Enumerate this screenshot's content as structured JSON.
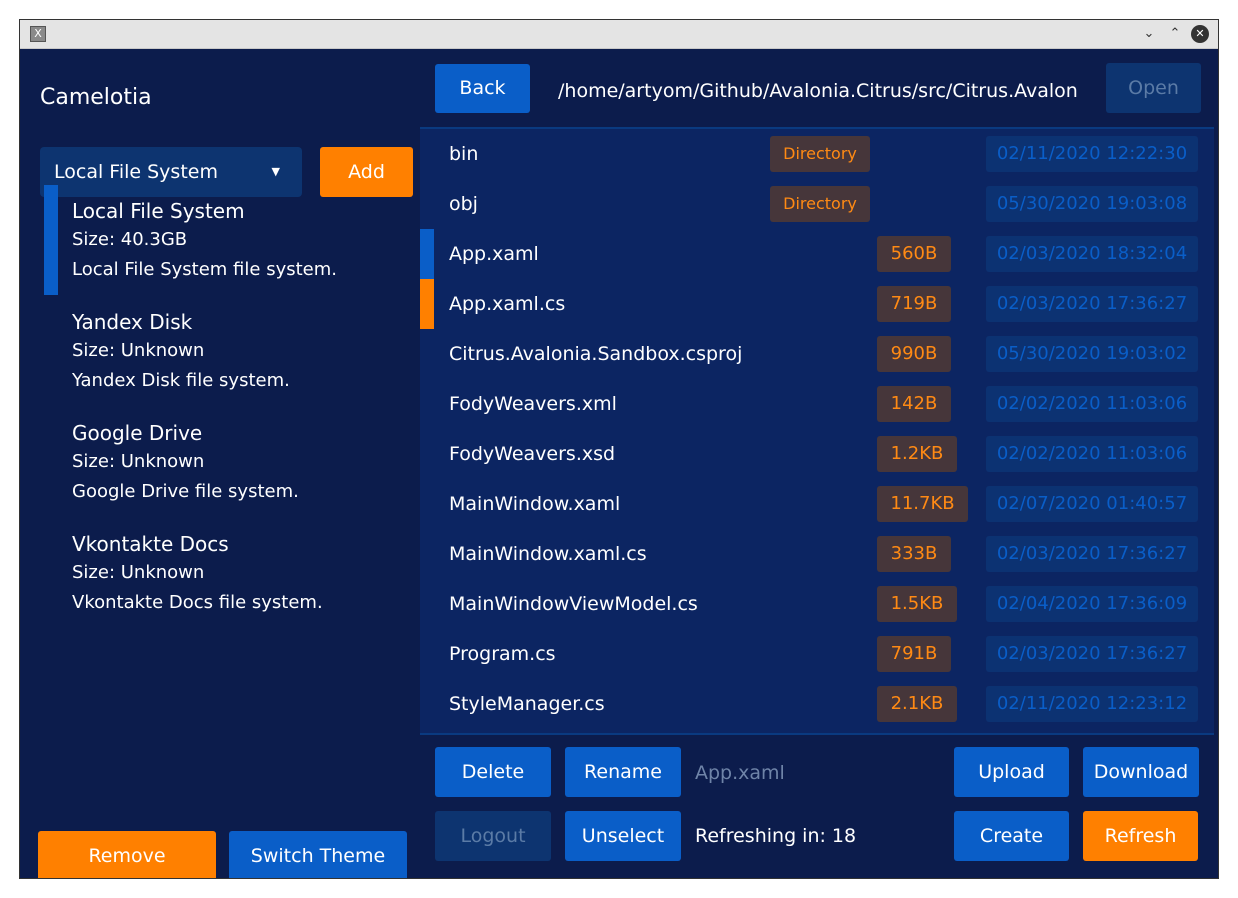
{
  "window": {
    "app_icon": "app-icon",
    "controls": {
      "minimize": "⌄",
      "maximize": "⌃",
      "close": "✕"
    }
  },
  "sidebar": {
    "title": "Camelotia",
    "selector_value": "Local File System",
    "selector_caret": "▼",
    "add_label": "Add",
    "providers": [
      {
        "name": "Local File System",
        "size": "Size: 40.3GB",
        "description": "Local File System file system.",
        "selected": true
      },
      {
        "name": "Yandex Disk",
        "size": "Size: Unknown",
        "description": "Yandex Disk file system.",
        "selected": false
      },
      {
        "name": "Google Drive",
        "size": "Size: Unknown",
        "description": "Google Drive file system.",
        "selected": false
      },
      {
        "name": "Vkontakte Docs",
        "size": "Size: Unknown",
        "description": "Vkontakte Docs file system.",
        "selected": false
      }
    ],
    "remove_label": "Remove",
    "switch_theme_label": "Switch Theme"
  },
  "toolbar": {
    "back_label": "Back",
    "path": "/home/artyom/Github/Avalonia.Citrus/src/Citrus.Avalonia.Sandbox",
    "open_label": "Open"
  },
  "files": [
    {
      "name": "bin",
      "tag": "Directory",
      "date": "02/11/2020 12:22:30",
      "marker": ""
    },
    {
      "name": "obj",
      "tag": "Directory",
      "date": "05/30/2020 19:03:08",
      "marker": ""
    },
    {
      "name": "App.xaml",
      "tag": "560B",
      "date": "02/03/2020 18:32:04",
      "marker": "#0a5ec8"
    },
    {
      "name": "App.xaml.cs",
      "tag": "719B",
      "date": "02/03/2020 17:36:27",
      "marker": "#ff8000"
    },
    {
      "name": "Citrus.Avalonia.Sandbox.csproj",
      "tag": "990B",
      "date": "05/30/2020 19:03:02",
      "marker": ""
    },
    {
      "name": "FodyWeavers.xml",
      "tag": "142B",
      "date": "02/02/2020 11:03:06",
      "marker": ""
    },
    {
      "name": "FodyWeavers.xsd",
      "tag": "1.2KB",
      "date": "02/02/2020 11:03:06",
      "marker": ""
    },
    {
      "name": "MainWindow.xaml",
      "tag": "11.7KB",
      "date": "02/07/2020 01:40:57",
      "marker": ""
    },
    {
      "name": "MainWindow.xaml.cs",
      "tag": "333B",
      "date": "02/03/2020 17:36:27",
      "marker": ""
    },
    {
      "name": "MainWindowViewModel.cs",
      "tag": "1.5KB",
      "date": "02/04/2020 17:36:09",
      "marker": ""
    },
    {
      "name": "Program.cs",
      "tag": "791B",
      "date": "02/03/2020 17:36:27",
      "marker": ""
    },
    {
      "name": "StyleManager.cs",
      "tag": "2.1KB",
      "date": "02/11/2020 12:23:12",
      "marker": ""
    }
  ],
  "actions": {
    "delete_label": "Delete",
    "rename_label": "Rename",
    "selected_file": "App.xaml",
    "upload_label": "Upload",
    "download_label": "Download",
    "logout_label": "Logout",
    "unselect_label": "Unselect",
    "refresh_status": "Refreshing in: 18",
    "create_label": "Create",
    "refresh_label": "Refresh"
  },
  "colors": {
    "background": "#0c1c4c",
    "panel": "#0c2562",
    "accent_blue": "#0a5ec8",
    "accent_orange": "#ff8000",
    "tag_background": "#46363a",
    "date_background": "#0c3272"
  }
}
